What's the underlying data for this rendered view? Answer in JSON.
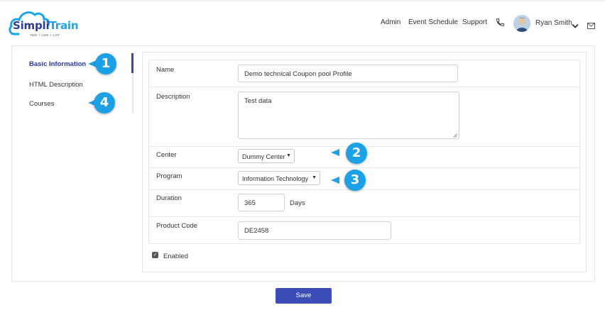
{
  "brand": {
    "name_part1": "Simpli",
    "name_part2": "Train",
    "tagline": "TMS + LMS + LXP"
  },
  "nav": {
    "admin": "Admin",
    "event_schedule": "Event Schedule",
    "support": "Support",
    "user_name": "Ryan Smith"
  },
  "sidebar": {
    "items": [
      {
        "label": "Basic Information",
        "active": true
      },
      {
        "label": "HTML Description",
        "active": false
      },
      {
        "label": "Courses",
        "active": false
      }
    ]
  },
  "form": {
    "name_label": "Name",
    "name_value": "Demo technical Coupon pool Profile",
    "description_label": "Description",
    "description_value": "Test data",
    "center_label": "Center",
    "center_value": "Dummy Center",
    "program_label": "Program",
    "program_value": "Information Technology",
    "duration_label": "Duration",
    "duration_value": "365",
    "duration_unit": "Days",
    "product_code_label": "Product Code",
    "product_code_value": "DE2458",
    "enabled_label": "Enabled",
    "enabled_checked": true
  },
  "actions": {
    "save_label": "Save"
  },
  "callouts": {
    "c1": "1",
    "c2": "2",
    "c3": "3",
    "c4": "4"
  },
  "icons": {
    "logo": "cloud-logo-icon",
    "phone": "phone-icon",
    "user_menu": "chevron-down-icon",
    "mail": "mail-icon",
    "select_caret": "caret-down-icon",
    "checkbox": "checkmark-icon"
  },
  "colors": {
    "accent": "#3d4db7",
    "active_nav": "#2b3a94",
    "callout": "#1da1e6",
    "logo_blue": "#1aa5e6"
  }
}
